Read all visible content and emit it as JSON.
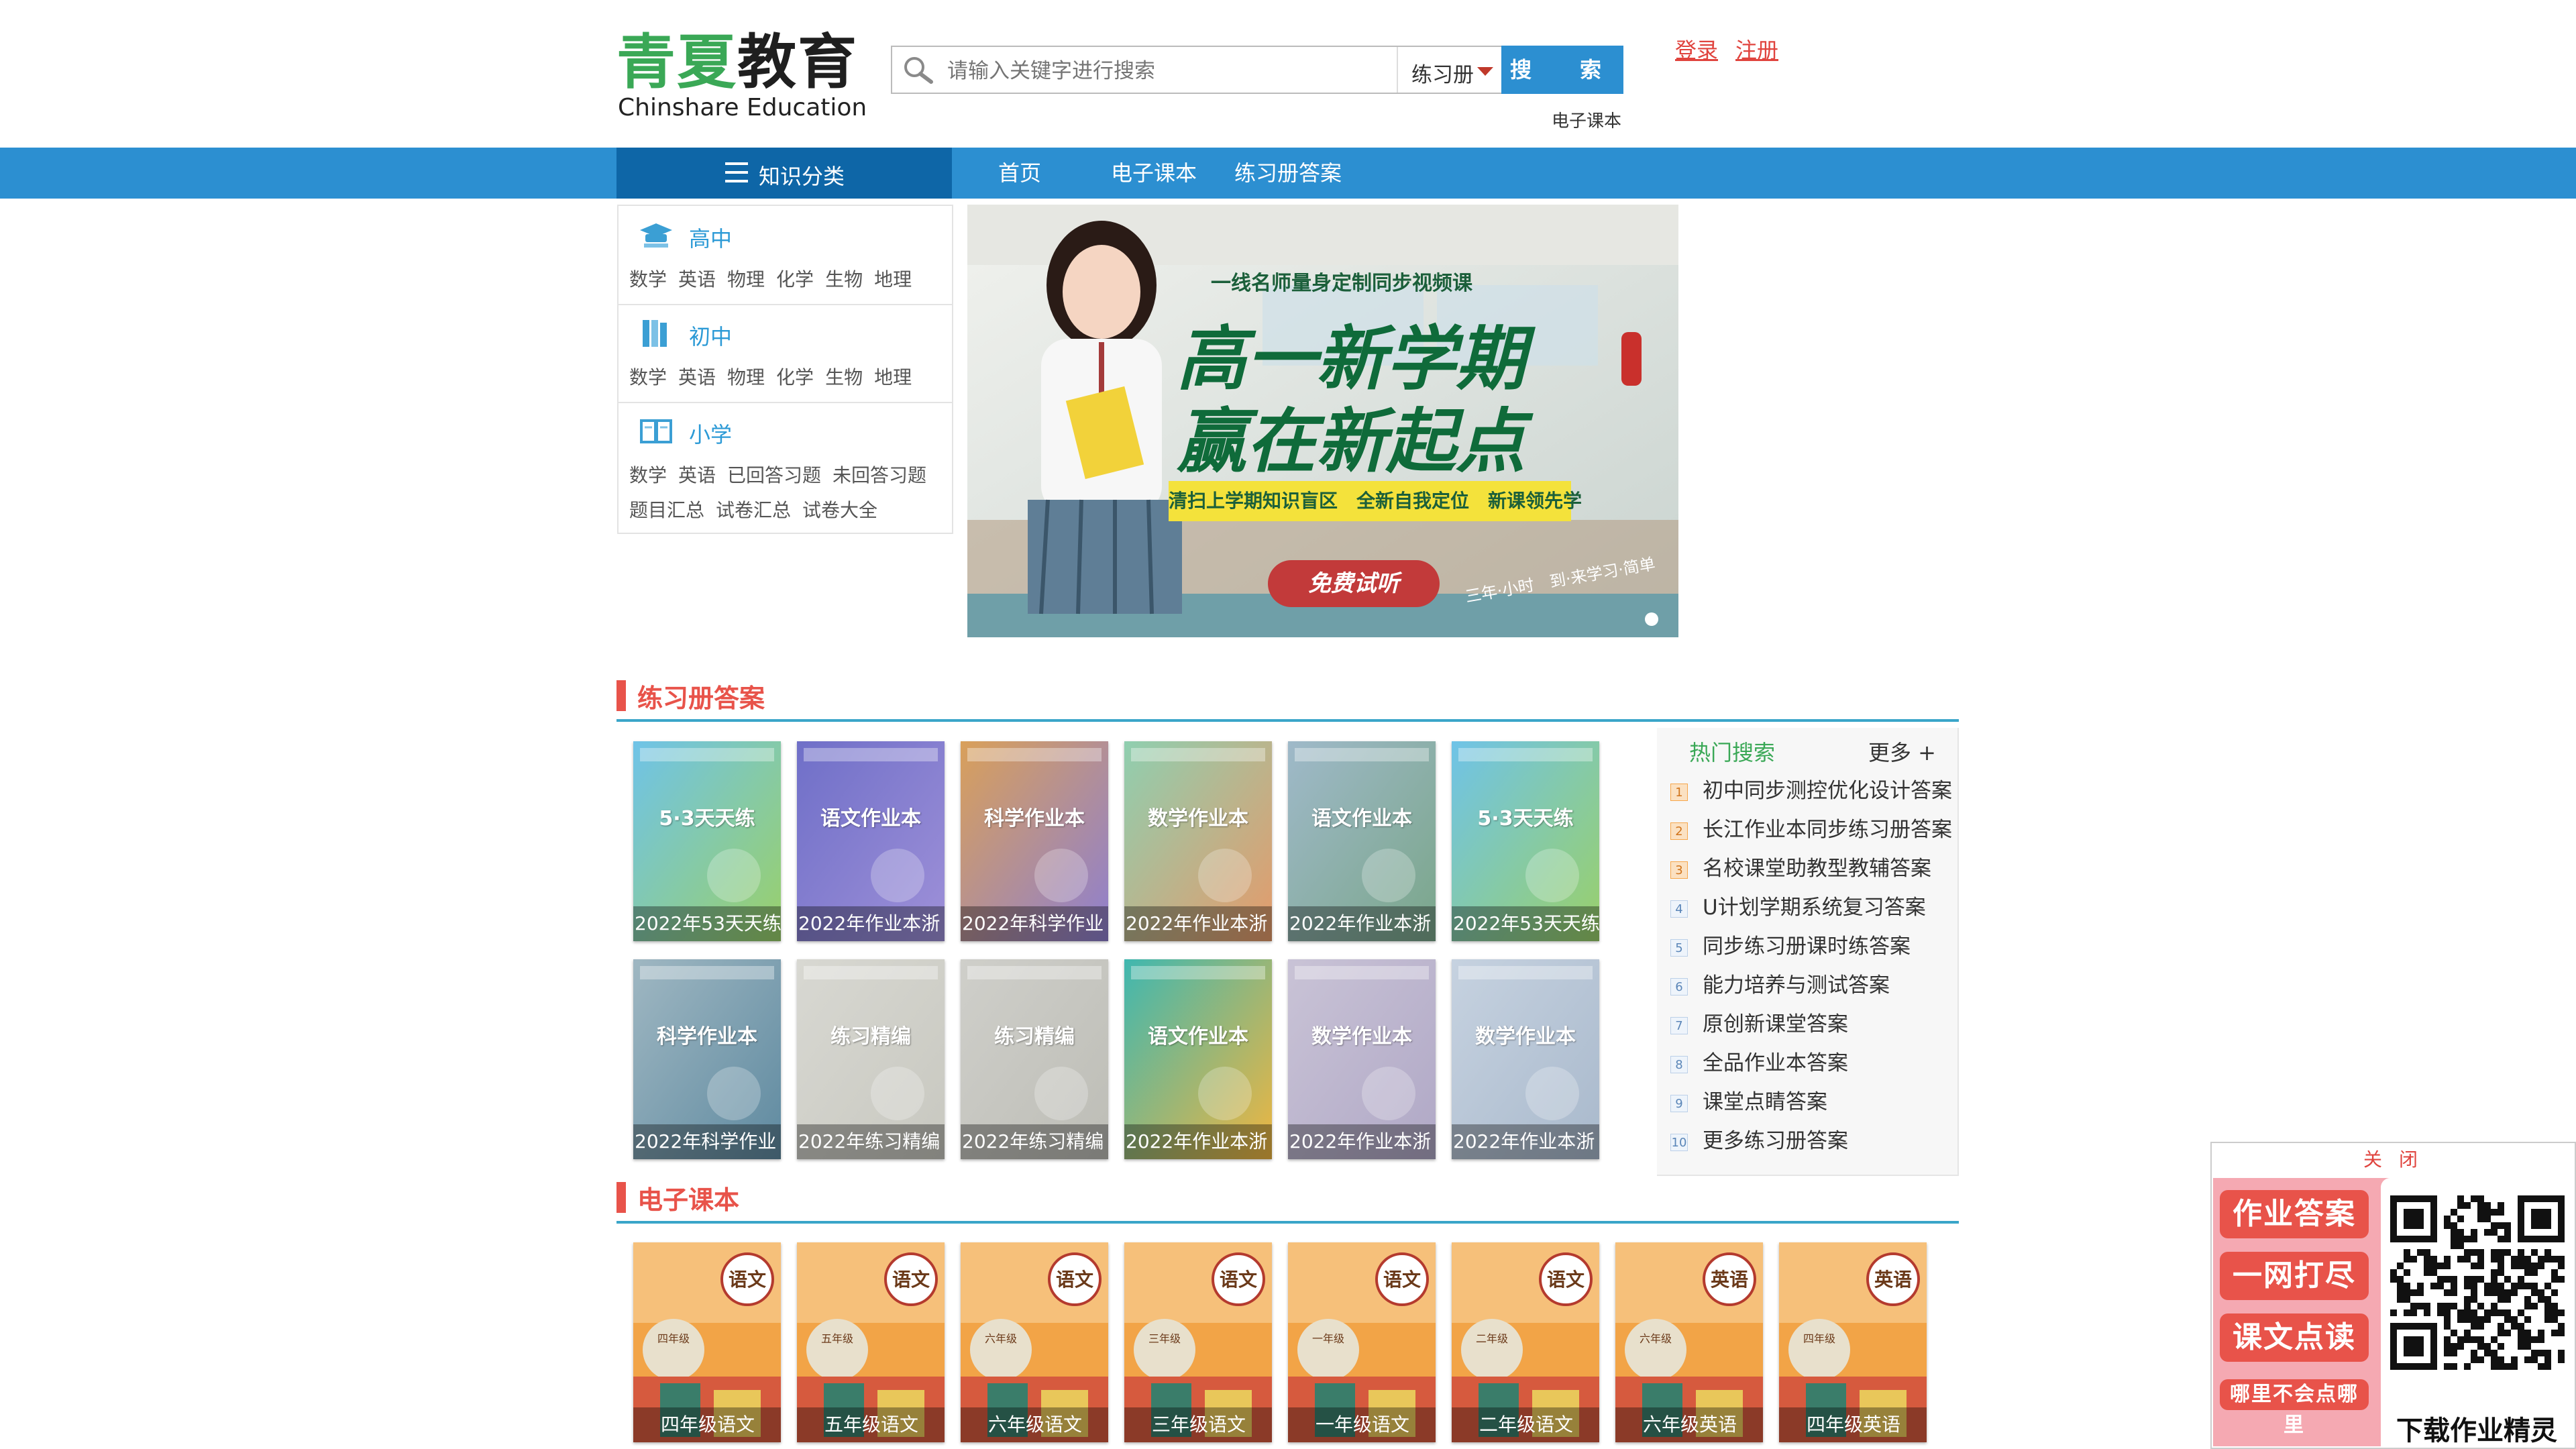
{
  "brand": {
    "name_green": "青夏",
    "name_dark": "教育",
    "name_en": "Chinshare Education"
  },
  "search": {
    "placeholder": "请输入关键字进行搜索",
    "select_value": "练习册",
    "button_label": "搜　索",
    "under_link": "电子课本"
  },
  "auth": {
    "login": "登录",
    "register": "注册"
  },
  "nav": {
    "category_label": "知识分类",
    "items": [
      "首页",
      "电子课本",
      "练习册答案"
    ]
  },
  "categories": [
    {
      "title": "高中",
      "links": [
        "数学",
        "英语",
        "物理",
        "化学",
        "生物",
        "地理"
      ]
    },
    {
      "title": "初中",
      "links": [
        "数学",
        "英语",
        "物理",
        "化学",
        "生物",
        "地理"
      ]
    },
    {
      "title": "小学",
      "links": [
        "数学",
        "英语",
        "已回答习题",
        "未回答习题"
      ],
      "links2": [
        "题目汇总",
        "试卷汇总",
        "试卷大全"
      ]
    }
  ],
  "banner": {
    "kicker": "一线名师量身定制同步视频课",
    "headline1": "高一新学期",
    "headline2": "赢在新起点",
    "subline": "清扫上学期知识盲区　全新自我定位　新课领先学",
    "cta": "免费试听",
    "script_text": "三年·小时　到·来学习·简单"
  },
  "workbooks": {
    "section_title": "练习册答案",
    "items": [
      {
        "caption": "2022年53天天练",
        "colors": [
          "#6fc3e8",
          "#9ad06a"
        ],
        "title": "5·3天天练"
      },
      {
        "caption": "2022年作业本浙",
        "colors": [
          "#6f6fc8",
          "#9e90d8"
        ],
        "title": "语文作业本"
      },
      {
        "caption": "2022年科学作业",
        "colors": [
          "#d9a05a",
          "#8e7fd0"
        ],
        "title": "科学作业本"
      },
      {
        "caption": "2022年作业本浙",
        "colors": [
          "#8fcfb0",
          "#e59a6a"
        ],
        "title": "数学作业本"
      },
      {
        "caption": "2022年作业本浙",
        "colors": [
          "#9fb9c9",
          "#7aa68a"
        ],
        "title": "语文作业本"
      },
      {
        "caption": "2022年53天天练",
        "colors": [
          "#6fc3e8",
          "#9ad06a"
        ],
        "title": "5·3天天练"
      },
      {
        "caption": "2022年科学作业",
        "colors": [
          "#9fb7c2",
          "#5f8aa0"
        ],
        "title": "科学作业本"
      },
      {
        "caption": "2022年练习精编",
        "colors": [
          "#d8d8d2",
          "#c8c8c0"
        ],
        "title": "练习精编"
      },
      {
        "caption": "2022年练习精编",
        "colors": [
          "#cfcfca",
          "#bdbdb6"
        ],
        "title": "练习精编"
      },
      {
        "caption": "2022年作业本浙",
        "colors": [
          "#3fb7b0",
          "#f0b640"
        ],
        "title": "语文作业本"
      },
      {
        "caption": "2022年作业本浙",
        "colors": [
          "#c9c3d6",
          "#b0a8c6"
        ],
        "title": "数学作业本"
      },
      {
        "caption": "2022年作业本浙",
        "colors": [
          "#c6d2e0",
          "#a9b9cc"
        ],
        "title": "数学作业本"
      }
    ]
  },
  "hot_search": {
    "title": "热门搜索",
    "more": "更多 +",
    "items": [
      {
        "rank": "1",
        "text": "初中同步测控优化设计答案"
      },
      {
        "rank": "2",
        "text": "长江作业本同步练习册答案"
      },
      {
        "rank": "3",
        "text": "名校课堂助教型教辅答案"
      },
      {
        "rank": "4",
        "text": "U计划学期系统复习答案"
      },
      {
        "rank": "5",
        "text": "同步练习册课时练答案"
      },
      {
        "rank": "6",
        "text": "能力培养与测试答案"
      },
      {
        "rank": "7",
        "text": "原创新课堂答案"
      },
      {
        "rank": "8",
        "text": "全品作业本答案"
      },
      {
        "rank": "9",
        "text": "课堂点睛答案"
      },
      {
        "rank": "10",
        "text": "更多练习册答案"
      }
    ]
  },
  "ebooks": {
    "section_title": "电子课本",
    "items": [
      {
        "caption": "四年级语文",
        "badge": "语文",
        "grade": "四年级"
      },
      {
        "caption": "五年级语文",
        "badge": "语文",
        "grade": "五年级"
      },
      {
        "caption": "六年级语文",
        "badge": "语文",
        "grade": "六年级"
      },
      {
        "caption": "三年级语文",
        "badge": "语文",
        "grade": "三年级"
      },
      {
        "caption": "一年级语文",
        "badge": "语文",
        "grade": "一年级"
      },
      {
        "caption": "二年级语文",
        "badge": "语文",
        "grade": "二年级"
      },
      {
        "caption": "六年级英语",
        "badge": "英语",
        "grade": "六年级"
      },
      {
        "caption": "四年级英语",
        "badge": "英语",
        "grade": "四年级"
      }
    ]
  },
  "popup": {
    "close_label": "关 闭",
    "tags": [
      "作业答案",
      "一网打尽",
      "课文点读",
      "哪里不会点哪里"
    ],
    "qr_caption": "下载作业精灵"
  }
}
